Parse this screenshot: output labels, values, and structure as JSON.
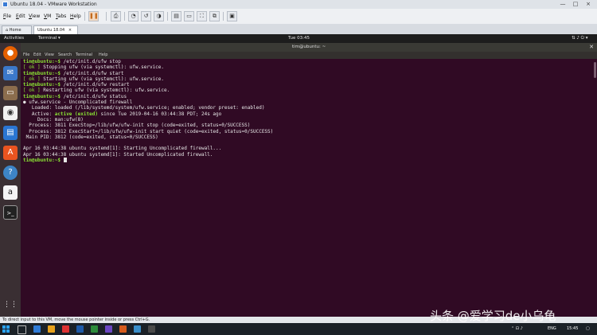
{
  "vmware": {
    "window_title": "Ubuntu 18.04 - VMware Workstation",
    "controls": [
      "—",
      "□",
      "×"
    ],
    "menus": [
      {
        "key": "F",
        "rest": "ile"
      },
      {
        "key": "E",
        "rest": "dit"
      },
      {
        "key": "V",
        "rest": "iew"
      },
      {
        "key": "V",
        "rest": "M"
      },
      {
        "key": "T",
        "rest": "abs"
      },
      {
        "key": "H",
        "rest": "elp"
      }
    ],
    "tabs": [
      {
        "label": "⌂ Home",
        "close": "×"
      },
      {
        "label": "Ubuntu 18.04",
        "close": "×"
      }
    ],
    "status_text": "To direct input to this VM, move the mouse pointer inside or press Ctrl+G."
  },
  "ubuntu": {
    "activities": "Activities",
    "app_menu": "Terminal ▾",
    "clock": "Tue 03:45",
    "system_icons": "⇅ ♪ ⏻ ▾"
  },
  "terminal": {
    "title": "tim@ubuntu: ~",
    "menus": [
      "File",
      "Edit",
      "View",
      "Search",
      "Terminal",
      "Help"
    ],
    "lines": [
      {
        "prompt": "tim@ubuntu:~$",
        "text": " /etc/init.d/ufw stop"
      },
      {
        "ok": "[ ok ]",
        "text": " Stopping ufw (via systemctl): ufw.service."
      },
      {
        "prompt": "tim@ubuntu:~$",
        "text": " /etc/init.d/ufw start"
      },
      {
        "ok": "[ ok ]",
        "text": " Starting ufw (via systemctl): ufw.service."
      },
      {
        "prompt": "tim@ubuntu:~$",
        "text": " /etc/init.d/ufw restart"
      },
      {
        "ok": "[ ok ]",
        "text": " Restarting ufw (via systemctl): ufw.service."
      },
      {
        "prompt": "tim@ubuntu:~$",
        "text": " /etc/init.d/ufw status"
      },
      {
        "text": "● ufw.service - Uncomplicated firewall"
      },
      {
        "text": "   Loaded: loaded (/lib/systemd/system/ufw.service; enabled; vendor preset: enabled)"
      },
      {
        "text": "   Active: ",
        "green": "active (exited)",
        "after": " since Tue 2019-04-16 03:44:38 PDT; 24s ago"
      },
      {
        "text": "     Docs: man:ufw(8)"
      },
      {
        "text": "  Process: 3811 ExecStop=/lib/ufw/ufw-init stop (code=exited, status=0/SUCCESS)"
      },
      {
        "text": "  Process: 3812 ExecStart=/lib/ufw/ufw-init start quiet (code=exited, status=0/SUCCESS)"
      },
      {
        "text": " Main PID: 3812 (code=exited, status=0/SUCCESS)"
      },
      {
        "text": ""
      },
      {
        "text": "Apr 16 03:44:38 ubuntu systemd[1]: Starting Uncomplicated firewall..."
      },
      {
        "text": "Apr 16 03:44:38 ubuntu systemd[1]: Started Uncomplicated firewall."
      },
      {
        "prompt": "tim@ubuntu:~$",
        "text": " ",
        "cursor": true
      }
    ]
  },
  "taskbar": {
    "lang": "ENG",
    "time": "15:45"
  },
  "watermark": "头条 @爱学习de小乌龟",
  "colors": {
    "terminal_bg": "#300a24",
    "prompt_green": "#8ae234",
    "dock_bg": "#3a2f33",
    "taskbar_bg": "#1b2127"
  }
}
